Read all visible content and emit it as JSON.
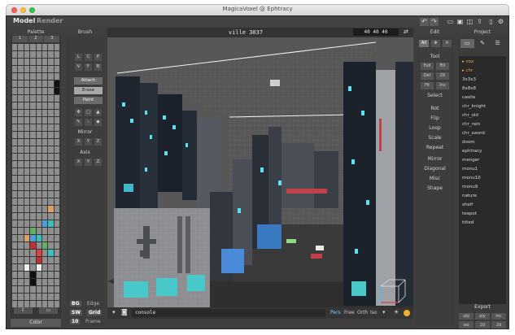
{
  "window": {
    "title": "MagicaVoxel @ Ephtracy"
  },
  "topbar": {
    "modes": [
      "Model",
      "Render"
    ]
  },
  "palette": {
    "title": "Palette",
    "headers": [
      "1",
      "2",
      "3"
    ],
    "color_label": "Color",
    "colors": {
      "base": "#8f8f8f",
      "orange": "#e0a060",
      "blue": "#4aa0d8",
      "teal": "#38c0c0",
      "green": "#60b060",
      "red": "#c03030",
      "brightred": "#e04040",
      "white": "#f0f0f0",
      "black": "#111111"
    }
  },
  "brush": {
    "title": "Brush",
    "types": [
      "L",
      "C",
      "P",
      "V",
      "F",
      "B"
    ],
    "modes": [
      "Attach",
      "Erase",
      "Paint"
    ],
    "mirror_label": "Mirror",
    "axis_label": "Axis",
    "axes": [
      "X",
      "Y",
      "Z"
    ]
  },
  "render_opts": {
    "items": [
      "BG",
      "Edge",
      "SW",
      "Grid",
      "10",
      "Frame"
    ]
  },
  "viewport": {
    "name": "ville 3037",
    "size": "40 40 40",
    "console_text": "console",
    "projections": [
      "Pers",
      "Free",
      "Orth",
      "Iso"
    ]
  },
  "edit": {
    "title": "Edit",
    "tabs": [
      "All"
    ],
    "tool_label": "Tool",
    "tool_buttons": [
      "Full",
      "Fill",
      "Del",
      "2X",
      "Fit",
      "Inv"
    ],
    "select_label": "Select",
    "ops": [
      "Rot",
      "Flip",
      "Loop",
      "Scale",
      "Repeat",
      "Mirror",
      "Diagonal",
      "Misc",
      "Shape"
    ]
  },
  "project": {
    "title": "Project",
    "items": [
      "vox",
      "chr",
      "3x3x3",
      "8x8x8",
      "castle",
      "chr_knight",
      "chr_old",
      "chr_rain",
      "chr_sword",
      "doom",
      "ephtracy",
      "menger",
      "monu1",
      "monu10",
      "monu9",
      "nature",
      "shelf",
      "teapot",
      "titled"
    ],
    "export_label": "Export",
    "export_buttons": [
      "obj",
      "ply",
      "mc",
      "xraw",
      "slab",
      "qb",
      "iso",
      "2d",
      "2d"
    ]
  }
}
